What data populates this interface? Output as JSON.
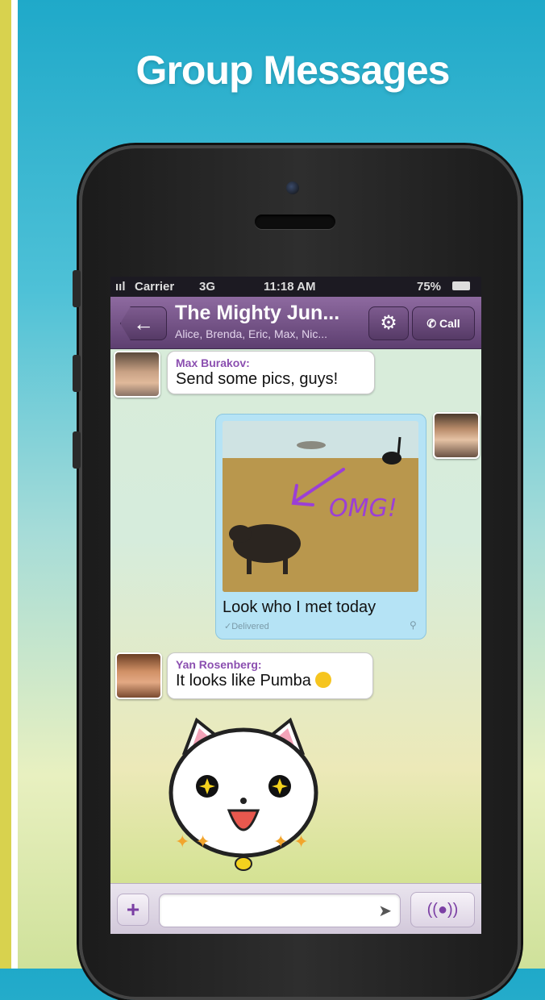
{
  "promo": {
    "title": "Group Messages"
  },
  "statusbar": {
    "carrier": "Carrier",
    "network": "3G",
    "time": "11:18 AM",
    "battery": "75%"
  },
  "navbar": {
    "title": "The Mighty Jun...",
    "subtitle": "Alice, Brenda, Eric, Max, Nic...",
    "back_icon": "back-arrow-icon",
    "settings_icon": "gear-icon",
    "call_label": "Call"
  },
  "messages": [
    {
      "sender": "Max Burakov:",
      "text": "Send some pics, guys!"
    },
    {
      "caption": "Look who I met today",
      "status": "Delivered",
      "photo_annotation": "OMG!"
    },
    {
      "sender": "Yan Rosenberg:",
      "text": "It looks like Pumba"
    }
  ],
  "input": {
    "placeholder": "",
    "attach_icon": "plus-icon",
    "send_icon": "send-icon",
    "voice_icon": "microphone-icon"
  },
  "colors": {
    "accent": "#7b3fa4",
    "navbar": "#6f4d83",
    "sender": "#8b4fb0",
    "photo_bubble": "#b5e3f5"
  }
}
